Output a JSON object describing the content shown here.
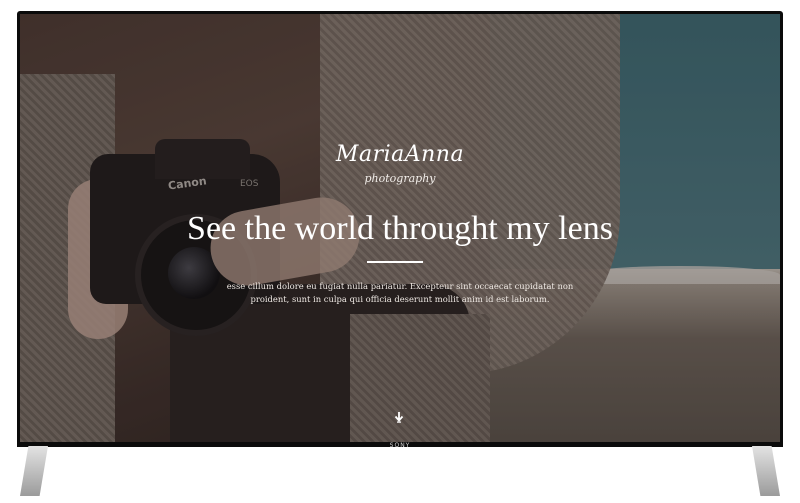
{
  "brand": {
    "name": "MariaAnna",
    "tagline": "photography"
  },
  "hero": {
    "headline": "See the world throught my lens",
    "description": "esse cillum dolore eu fugiat nulla pariatur. Excepteur sint occaecat cupidatat non proident, sunt in culpa qui officia deserunt mollit anim id est laborum.",
    "scroll_icon": "arrow-down-icon"
  },
  "camera": {
    "brand_text": "Canon",
    "model_text": "EOS"
  },
  "device": {
    "maker": "SONY"
  }
}
